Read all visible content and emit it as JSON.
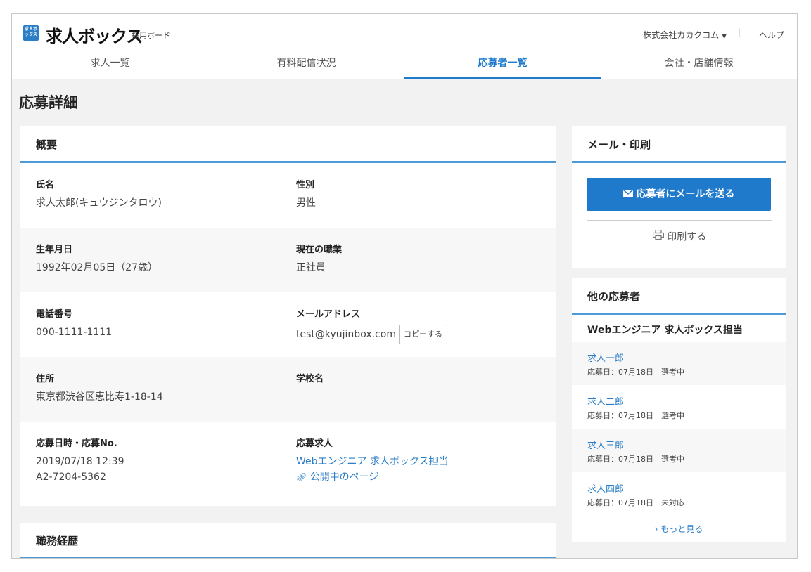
{
  "header": {
    "logo_mark": "求人ボックス",
    "logo": "求人ボックス",
    "logo_sub": "採用ボード",
    "company": "株式会社カカクコム",
    "separator": "|",
    "help": "ヘルプ",
    "icons": {
      "company_dropdown": "caret-down-icon"
    }
  },
  "tabs": [
    {
      "label": "求人一覧",
      "active": false
    },
    {
      "label": "有料配信状況",
      "active": false
    },
    {
      "label": "応募者一覧",
      "active": true
    },
    {
      "label": "会社・店舗情報",
      "active": false
    }
  ],
  "page_title": "応募詳細",
  "overview": {
    "heading": "概要",
    "name_label": "氏名",
    "name": "求人太郎(キュウジンタロウ)",
    "gender_label": "性別",
    "gender": "男性",
    "birth_label": "生年月日",
    "birth": "1992年02月05日（27歳）",
    "occupation_label": "現在の職業",
    "occupation": "正社員",
    "phone_label": "電話番号",
    "phone": "090-1111-1111",
    "email_label": "メールアドレス",
    "email": "test@kyujinbox.com",
    "copy_label": "コピーする",
    "address_label": "住所",
    "address": "東京都渋谷区恵比寿1-18-14",
    "school_label": "学校名",
    "school": "",
    "applied_label": "応募日時・応募No.",
    "applied_date": "2019/07/18 12:39",
    "applied_no": "A2-7204-5362",
    "job_label": "応募求人",
    "job_link": "Webエンジニア 求人ボックス担当",
    "public_page_link": "公開中のページ"
  },
  "career": {
    "heading": "職務経歴"
  },
  "mail_print": {
    "heading": "メール・印刷",
    "mail_button": "応募者にメールを送る",
    "print_button": "印刷する",
    "icons": {
      "mail": "mail-icon",
      "print": "printer-icon"
    }
  },
  "others": {
    "heading": "他の応募者",
    "job_title": "Webエンジニア 求人ボックス担当",
    "applicants": [
      {
        "name": "求人一郎",
        "meta": "応募日：07月18日　選考中"
      },
      {
        "name": "求人二郎",
        "meta": "応募日：07月18日　選考中"
      },
      {
        "name": "求人三郎",
        "meta": "応募日：07月18日　選考中"
      },
      {
        "name": "求人四郎",
        "meta": "応募日：07月18日　未対応"
      }
    ],
    "more": "もっと見る"
  },
  "colors": {
    "accent": "#1f7acb",
    "link": "#2a7dc6",
    "underline": "#4d9ad6"
  }
}
